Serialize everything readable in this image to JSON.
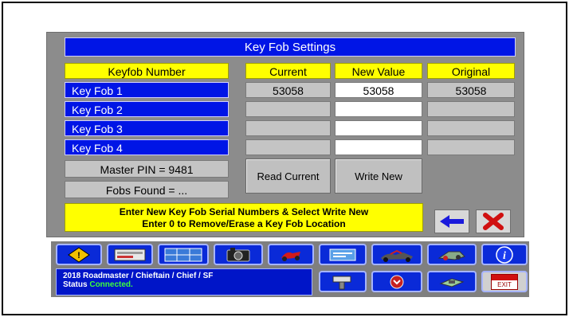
{
  "dialog": {
    "title": "Key Fob Settings",
    "headers": {
      "keyfob": "Keyfob Number",
      "current": "Current",
      "new_value": "New Value",
      "original": "Original"
    },
    "rows": [
      {
        "label": "Key Fob 1",
        "current": "53058",
        "new_value": "53058",
        "original": "53058"
      },
      {
        "label": "Key Fob 2",
        "current": "",
        "new_value": "",
        "original": ""
      },
      {
        "label": "Key Fob 3",
        "current": "",
        "new_value": "",
        "original": ""
      },
      {
        "label": "Key Fob 4",
        "current": "",
        "new_value": "",
        "original": ""
      }
    ],
    "master_pin": "Master PIN = 9481",
    "fobs_found": "Fobs Found = ...",
    "read_button": "Read Current",
    "write_button": "Write New",
    "message_line1": "Enter New Key Fob Serial Numbers & Select Write New",
    "message_line2": "Enter 0 to Remove/Erase a Key Fob Location"
  },
  "status": {
    "vehicle": "2018 Roadmaster / Chieftain / Chief / SF",
    "label": "Status",
    "value": "Connected."
  },
  "toolbar": {
    "exit_label": "EXIT",
    "icons": [
      "warning-icon",
      "gauge-icon",
      "table-icon",
      "camera-icon",
      "motorcycle-icon",
      "panel-icon",
      "bike-group-icon",
      "tool-icon",
      "info-icon",
      "scanner-icon",
      "ecu-icon",
      "module-icon",
      "exit-icon"
    ]
  },
  "colors": {
    "accent_blue": "#0015e6",
    "highlight_yellow": "#ffff00",
    "panel_gray": "#8c8c8c",
    "connected_green": "#3cff3c"
  }
}
